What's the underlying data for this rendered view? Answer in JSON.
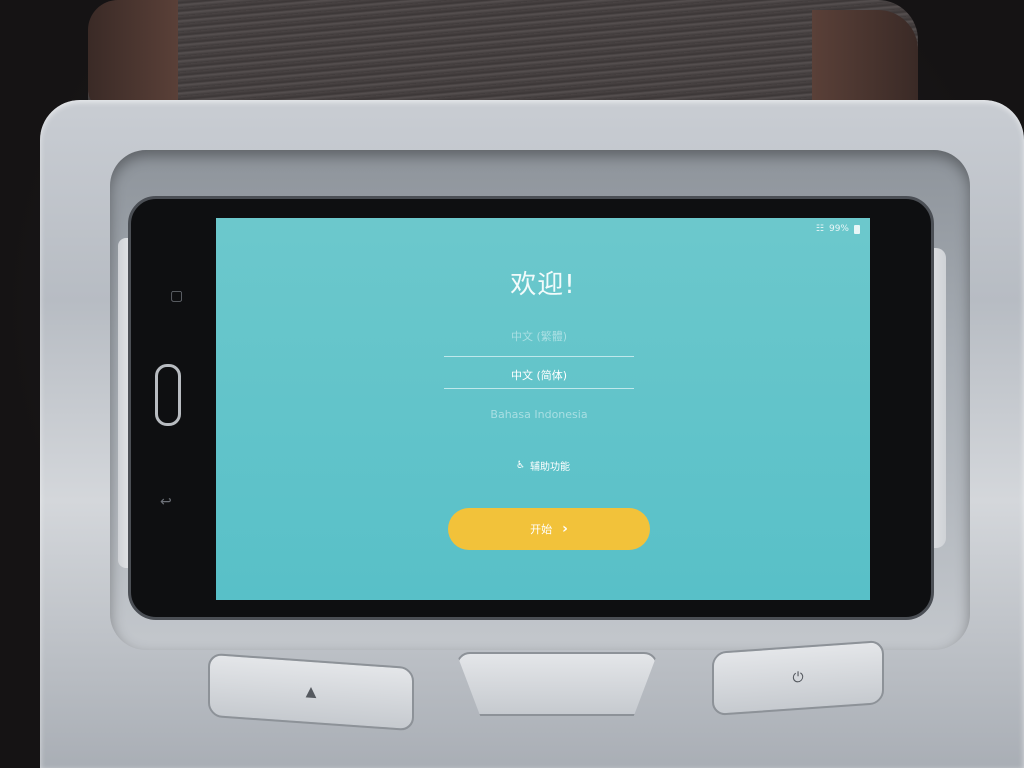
{
  "screen": {
    "status": {
      "battery": "99%"
    },
    "title": "欢迎!",
    "languages": [
      {
        "label": "中文 (繁體)",
        "selected": false
      },
      {
        "label": "中文 (简体)",
        "selected": true
      },
      {
        "label": "Bahasa Indonesia",
        "selected": false
      }
    ],
    "accessibility_label": "辅助功能",
    "start_button": {
      "label": "开始",
      "chevron": "›"
    }
  },
  "colors": {
    "screen_bg": "#5ec3ca",
    "start_button": "#f2c23a"
  },
  "icons": {
    "recent_apps": "recent-apps-icon",
    "back": "back-icon",
    "accessibility": "accessibility-icon",
    "eject": "eject-icon",
    "power": "power-icon",
    "battery": "battery-icon",
    "signal": "signal-icon"
  },
  "hardware_buttons": {
    "eject_symbol": "▲",
    "power_symbol": "⏻"
  }
}
